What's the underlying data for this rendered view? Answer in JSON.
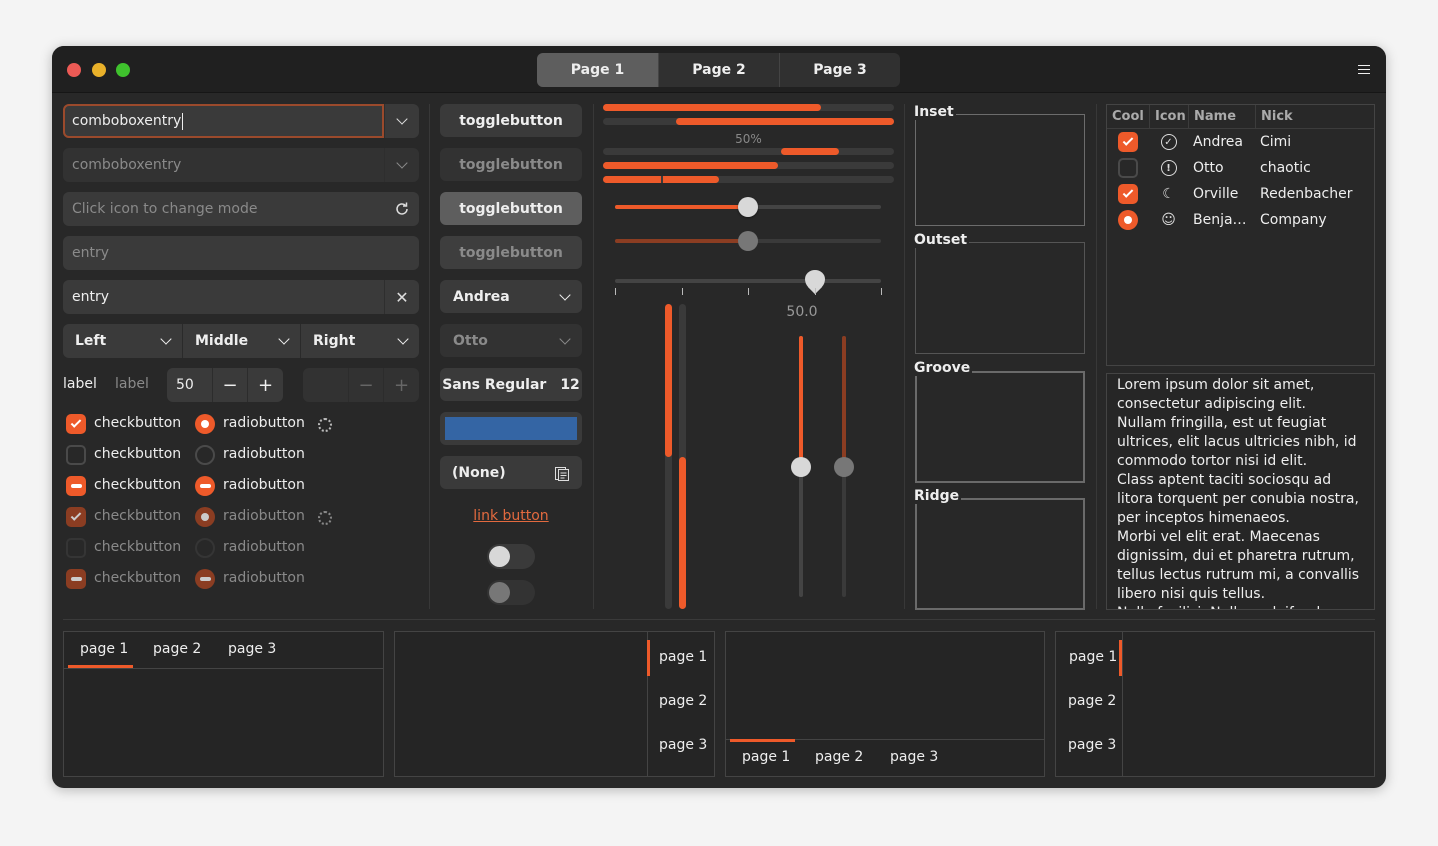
{
  "window": {
    "traffic_lights": {
      "close": "#ec5a55",
      "minimize": "#e9b12a",
      "maximize": "#3fc22d"
    },
    "stack_switcher": [
      "Page 1",
      "Page 2",
      "Page 3"
    ],
    "menu_icon": "hamburger-icon"
  },
  "colors": {
    "accent": "#ee5a2a",
    "accent_dim": "#8b3d22",
    "color_button": "#3465a4"
  },
  "entries": {
    "combo1": "comboboxentry",
    "combo2": "comboboxentry",
    "mode_placeholder": "Click icon to change mode",
    "entry_placeholder": "entry",
    "entry_value": "entry"
  },
  "segmented": [
    "Left",
    "Middle",
    "Right"
  ],
  "labels": [
    "label",
    "label"
  ],
  "spin": {
    "value": "50",
    "minus": "−",
    "plus": "+"
  },
  "checks": [
    {
      "label": "checkbutton",
      "state": "checked"
    },
    {
      "label": "checkbutton",
      "state": "unchecked"
    },
    {
      "label": "checkbutton",
      "state": "mixed"
    },
    {
      "label": "checkbutton",
      "state": "checked",
      "disabled": true
    },
    {
      "label": "checkbutton",
      "state": "unchecked",
      "disabled": true
    },
    {
      "label": "checkbutton",
      "state": "mixed",
      "disabled": true
    }
  ],
  "radios": [
    {
      "label": "radiobutton",
      "state": "checked"
    },
    {
      "label": "radiobutton",
      "state": "unchecked"
    },
    {
      "label": "radiobutton",
      "state": "mixed"
    },
    {
      "label": "radiobutton",
      "state": "checked",
      "disabled": true
    },
    {
      "label": "radiobutton",
      "state": "unchecked",
      "disabled": true
    },
    {
      "label": "radiobutton",
      "state": "mixed",
      "disabled": true
    }
  ],
  "buttons": {
    "toggles": [
      "togglebutton",
      "togglebutton",
      "togglebutton",
      "togglebutton"
    ],
    "combo1": "Andrea",
    "combo2": "Otto",
    "font": "Sans Regular",
    "font_size": "12",
    "file": "(None)",
    "link": "link button",
    "switches": [
      false,
      false
    ]
  },
  "progress": {
    "bar1": 0.75,
    "bar2_start": 0.25,
    "label": "50%",
    "bar3_pulse": [
      0.61,
      0.81
    ],
    "bar4": 0.6,
    "bar5_segments": [
      0.2,
      0.4
    ],
    "scale1": 0.5,
    "scale2": 0.5,
    "scale3": 0.75,
    "scale_value_label": "50.0",
    "vbar1": 0.5,
    "vbar2": 0.5,
    "vscale1": 0.5,
    "vscale2": 0.5
  },
  "frames": [
    "Inset",
    "Outset",
    "Groove",
    "Ridge"
  ],
  "tree": {
    "columns": [
      "Cool",
      "Icon",
      "Name",
      "Nick"
    ],
    "rows": [
      {
        "cool": "checked",
        "icon": "check-circle-icon",
        "name": "Andrea",
        "nick": "Cimi"
      },
      {
        "cool": "unchecked",
        "icon": "exclamation-circle-icon",
        "name": "Otto",
        "nick": "chaotic"
      },
      {
        "cool": "checked",
        "icon": "moon-icon",
        "name": "Orville",
        "nick": "Redenbacher"
      },
      {
        "cool": "radio",
        "icon": "robot-icon",
        "name": "Benja…",
        "nick": "Company"
      }
    ]
  },
  "text_view": "Lorem ipsum dolor sit amet, consectetur adipiscing elit.\nNullam fringilla, est ut feugiat ultrices, elit lacus ultricies nibh, id commodo tortor nisi id elit.\nClass aptent taciti sociosqu ad litora torquent per conubia nostra, per inceptos himenaeos.\nMorbi vel elit erat. Maecenas dignissim, dui et pharetra rutrum, tellus lectus rutrum mi, a convallis libero nisi quis tellus.\nNulla facilisi. Nullam eleifend lobortis",
  "notebooks": [
    {
      "position": "top",
      "tabs": [
        "page 1",
        "page 2",
        "page 3"
      ]
    },
    {
      "position": "right",
      "tabs": [
        "page 1",
        "page 2",
        "page 3"
      ]
    },
    {
      "position": "bottom",
      "tabs": [
        "page 1",
        "page 2",
        "page 3"
      ]
    },
    {
      "position": "left",
      "tabs": [
        "page 1",
        "page 2",
        "page 3"
      ]
    }
  ]
}
